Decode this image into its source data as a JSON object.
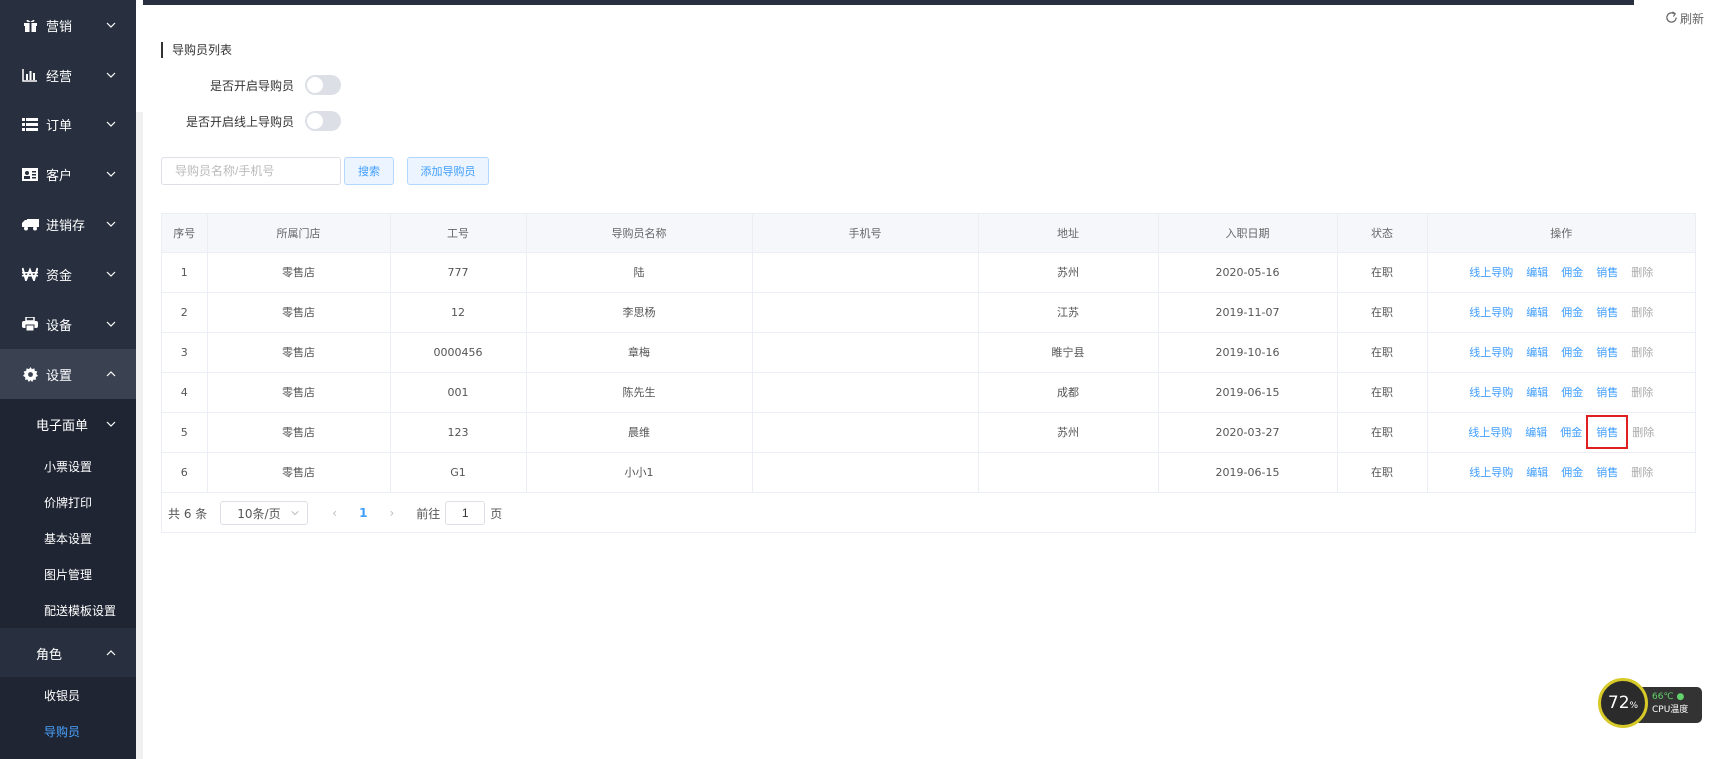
{
  "sidebar": {
    "items": [
      {
        "label": "营销",
        "icon": "gift-icon"
      },
      {
        "label": "经营",
        "icon": "bar-chart-icon"
      },
      {
        "label": "订单",
        "icon": "list-icon"
      },
      {
        "label": "客户",
        "icon": "id-card-icon"
      },
      {
        "label": "进销存",
        "icon": "truck-icon"
      },
      {
        "label": "资金",
        "icon": "won-icon"
      },
      {
        "label": "设备",
        "icon": "printer-icon"
      },
      {
        "label": "设置",
        "icon": "gear-icon"
      }
    ],
    "settings_sub": {
      "group1_label": "电子面单",
      "group1_items": [
        "小票设置",
        "价牌打印",
        "基本设置",
        "图片管理",
        "配送模板设置"
      ],
      "group2_label": "角色",
      "group2_items": [
        "收银员",
        "导购员"
      ]
    }
  },
  "header": {
    "refresh_label": "刷新"
  },
  "main": {
    "section_title": "导购员列表",
    "switch1_label": "是否开启导购员",
    "switch2_label": "是否开启线上导购员",
    "search_placeholder": "导购员名称/手机号",
    "search_button": "搜索",
    "add_button": "添加导购员"
  },
  "table": {
    "headers": [
      "序号",
      "所属门店",
      "工号",
      "导购员名称",
      "手机号",
      "地址",
      "入职日期",
      "状态",
      "操作"
    ],
    "rows": [
      {
        "no": "1",
        "store": "零售店",
        "id": "777",
        "name": "陆",
        "phone": "",
        "address": "苏州",
        "date": "2020-05-16",
        "status": "在职"
      },
      {
        "no": "2",
        "store": "零售店",
        "id": "12",
        "name": "李思杨",
        "phone": "",
        "address": "江苏",
        "date": "2019-11-07",
        "status": "在职"
      },
      {
        "no": "3",
        "store": "零售店",
        "id": "0000456",
        "name": "章梅",
        "phone": "",
        "address": "睢宁县",
        "date": "2019-10-16",
        "status": "在职"
      },
      {
        "no": "4",
        "store": "零售店",
        "id": "001",
        "name": "陈先生",
        "phone": "",
        "address": "成都",
        "date": "2019-06-15",
        "status": "在职"
      },
      {
        "no": "5",
        "store": "零售店",
        "id": "123",
        "name": "晨维",
        "phone": "",
        "address": "苏州",
        "date": "2020-03-27",
        "status": "在职"
      },
      {
        "no": "6",
        "store": "零售店",
        "id": "G1",
        "name": "小小1",
        "phone": "",
        "address": "",
        "date": "2019-06-15",
        "status": "在职"
      }
    ],
    "ops": {
      "online": "线上导购",
      "edit": "编辑",
      "commission": "佣金",
      "sales": "销售",
      "delete": "删除"
    }
  },
  "pager": {
    "total": "共 6 条",
    "page_size": "10条/页",
    "current_page": "1",
    "goto_label": "前往",
    "goto_value": "1",
    "page_unit": "页"
  },
  "cpu_widget": {
    "percent": "72",
    "percent_sign": "%",
    "temp": "66℃",
    "label": "CPU温度"
  }
}
